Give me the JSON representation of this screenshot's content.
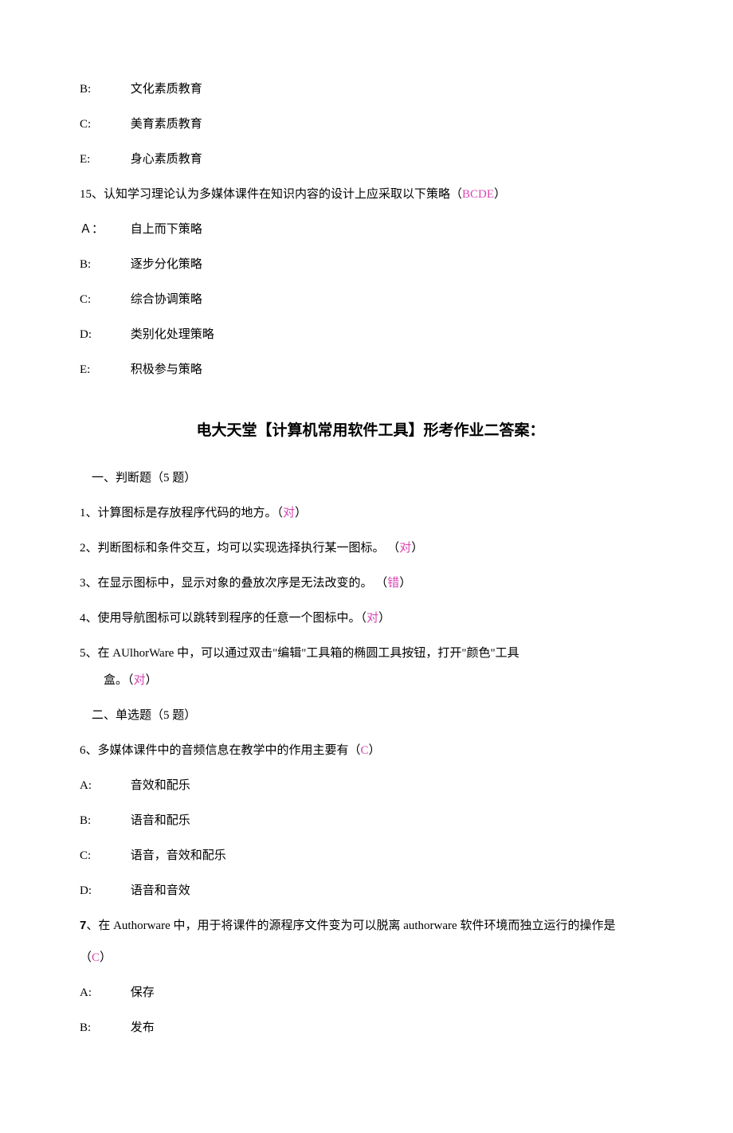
{
  "top_options": {
    "b_label": "B:",
    "b_text": "文化素质教育",
    "c_label": "C:",
    "c_text": "美育素质教育",
    "e_label": "E:",
    "e_text": "身心素质教育"
  },
  "q15": {
    "prefix": "15、认知学习理论认为多媒体课件在知识内容的设计上应采取以下策略（",
    "answer": "BCDE",
    "suffix": "）",
    "a_label": "Ａ：",
    "a_text": "自上而下策略",
    "b_label": "B:",
    "b_text": "逐步分化策略",
    "c_label": "C:",
    "c_text": "综合协调策略",
    "d_label": "D:",
    "d_text": "类别化处理策略",
    "e_label": "E:",
    "e_text": "积极参与策略"
  },
  "title": "电大天堂【计算机常用软件工具】形考作业二答案：",
  "section1": "一、判断题（5 题）",
  "q1": {
    "text": "1、计算图标是存放程序代码的地方。（",
    "answer": "对",
    "suffix": "）"
  },
  "q2": {
    "text": "2、判断图标和条件交互，均可以实现选择执行某一图标。 （",
    "answer": "对",
    "suffix": "）"
  },
  "q3": {
    "text": "3、在显示图标中，显示对象的叠放次序是无法改变的。 （",
    "answer": "错",
    "suffix": "）"
  },
  "q4": {
    "text": "4、使用导航图标可以跳转到程序的任意一个图标中。（",
    "answer": "对",
    "suffix": "）"
  },
  "q5": {
    "text": "5、在 AUlhorWare 中，可以通过双击\"编辑\"工具箱的椭圆工具按钮，打开\"颜色\"工具",
    "cont": "盒。（",
    "answer": "对",
    "suffix": "）"
  },
  "section2": "二、单选题（5 题）",
  "q6": {
    "text": "6、多媒体课件中的音频信息在教学中的作用主要有（",
    "answer": "C",
    "suffix": "）",
    "a_label": "A:",
    "a_text": "音效和配乐",
    "b_label": "B:",
    "b_text": "语音和配乐",
    "c_label": "C:",
    "c_text": "语音，音效和配乐",
    "d_label": "D:",
    "d_text": "语音和音效"
  },
  "q7": {
    "num": "7",
    "text": "、在 Authorware 中，用于将课件的源程序文件变为可以脱离 authorware 软件环境而独立运行的操作是",
    "paren_open": "（",
    "answer": "C",
    "paren_close": "）",
    "a_label": "A:",
    "a_text": "保存",
    "b_label": "B:",
    "b_text": "发布"
  }
}
